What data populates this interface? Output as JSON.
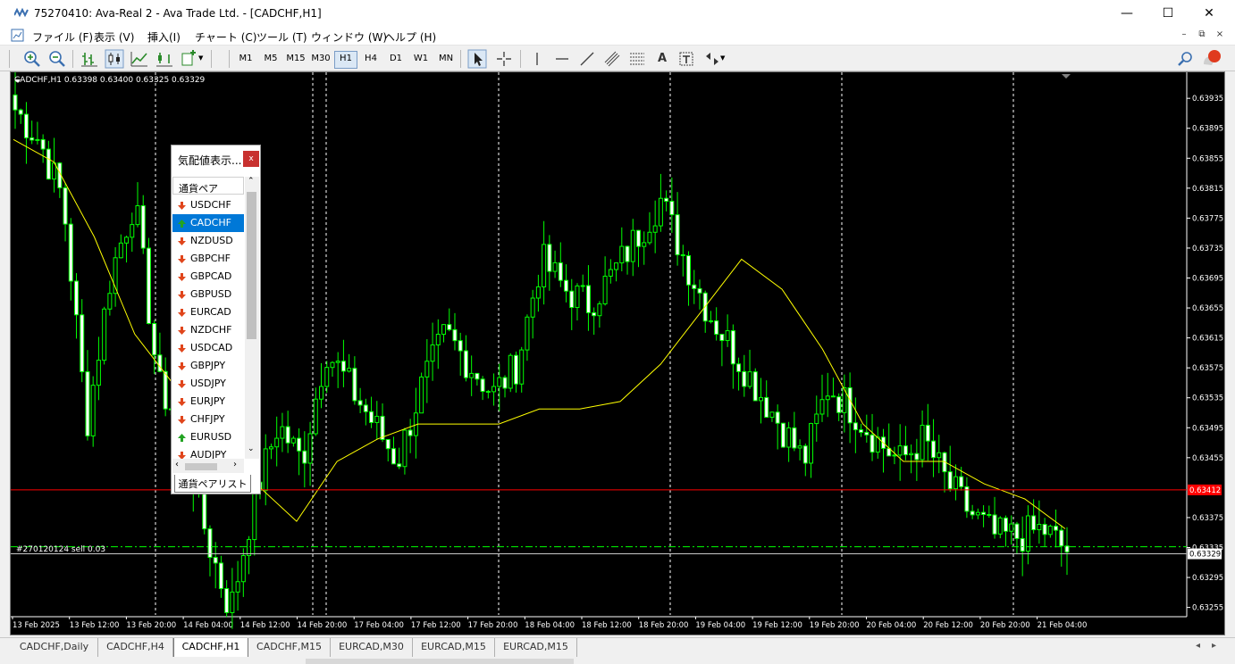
{
  "window": {
    "title": "75270410: Ava-Real 2 - Ava Trade Ltd. - [CADCHF,H1]"
  },
  "menu": [
    "ファイル (F)",
    "表示 (V)",
    "挿入(I)",
    "チャート (C)",
    "ツール (T)",
    "ウィンドウ (W)",
    "ヘルプ (H)"
  ],
  "toolbar": {
    "timeframes": [
      "M1",
      "M5",
      "M15",
      "M30",
      "H1",
      "H4",
      "D1",
      "W1",
      "MN"
    ],
    "active_timeframe": "H1",
    "notification_count": "1"
  },
  "chart": {
    "header": "CADCHF,H1  0.63398 0.63400 0.63325 0.63329",
    "order_label": "#270120124 sell 0.03",
    "bid_label": "0.63412",
    "current_label": "0.63329",
    "colors": {
      "candle_up": "#00ff00",
      "candle_down": "#ffffff",
      "ma": "#ffff00",
      "bid_line": "#ff0000",
      "order_line": "#00ff00"
    }
  },
  "chart_data": {
    "type": "candlestick",
    "symbol": "CADCHF",
    "timeframe": "H1",
    "y_ticks": [
      "0.63935",
      "0.63895",
      "0.63855",
      "0.63815",
      "0.63775",
      "0.63735",
      "0.63695",
      "0.63655",
      "0.63615",
      "0.63575",
      "0.63535",
      "0.63495",
      "0.63455",
      "0.63375",
      "0.63335",
      "0.63295",
      "0.63255"
    ],
    "ylim": [
      0.63245,
      0.63965
    ],
    "x_ticks": [
      "13 Feb 2025",
      "13 Feb 12:00",
      "13 Feb 20:00",
      "14 Feb 04:00",
      "14 Feb 12:00",
      "14 Feb 20:00",
      "17 Feb 04:00",
      "17 Feb 12:00",
      "17 Feb 20:00",
      "18 Feb 04:00",
      "18 Feb 12:00",
      "18 Feb 20:00",
      "19 Feb 04:00",
      "19 Feb 12:00",
      "19 Feb 20:00",
      "20 Feb 04:00",
      "20 Feb 12:00",
      "20 Feb 20:00",
      "21 Feb 04:00"
    ],
    "close_path": [
      0.6392,
      0.6388,
      0.638,
      0.635,
      0.637,
      0.638,
      0.6355,
      0.635,
      0.6335,
      0.6325,
      0.634,
      0.635,
      0.6345,
      0.636,
      0.6355,
      0.635,
      0.6345,
      0.6355,
      0.6362,
      0.6358,
      0.6354,
      0.6358,
      0.6372,
      0.6368,
      0.6366,
      0.637,
      0.6375,
      0.638,
      0.6372,
      0.6365,
      0.636,
      0.6355,
      0.635,
      0.6345,
      0.6355,
      0.6352,
      0.6348,
      0.6345,
      0.6348,
      0.6342,
      0.6338,
      0.6335,
      0.6335,
      0.6336,
      0.6333
    ],
    "ma_path": [
      0.6388,
      0.6385,
      0.6375,
      0.6362,
      0.6355,
      0.6348,
      0.6342,
      0.6337,
      0.6345,
      0.6348,
      0.635,
      0.635,
      0.635,
      0.6352,
      0.6352,
      0.6353,
      0.6358,
      0.6365,
      0.6372,
      0.6368,
      0.636,
      0.635,
      0.6345,
      0.6345,
      0.6342,
      0.634,
      0.6336
    ],
    "bid": 0.63412,
    "current": 0.63329,
    "order_level": 0.63336
  },
  "market_watch": {
    "title": "気配値表示...",
    "header": "通貨ペア",
    "symbols": [
      {
        "name": "USDCHF",
        "dir": "down"
      },
      {
        "name": "CADCHF",
        "dir": "up"
      },
      {
        "name": "NZDUSD",
        "dir": "down"
      },
      {
        "name": "GBPCHF",
        "dir": "down"
      },
      {
        "name": "GBPCAD",
        "dir": "down"
      },
      {
        "name": "GBPUSD",
        "dir": "down"
      },
      {
        "name": "EURCAD",
        "dir": "down"
      },
      {
        "name": "NZDCHF",
        "dir": "down"
      },
      {
        "name": "USDCAD",
        "dir": "down"
      },
      {
        "name": "GBPJPY",
        "dir": "down"
      },
      {
        "name": "USDJPY",
        "dir": "down"
      },
      {
        "name": "EURJPY",
        "dir": "down"
      },
      {
        "name": "CHFJPY",
        "dir": "down"
      },
      {
        "name": "EURUSD",
        "dir": "up"
      },
      {
        "name": "AUDJPY",
        "dir": "down"
      }
    ],
    "selected": "CADCHF",
    "tab": "通貨ペアリスト"
  },
  "tabs": [
    "CADCHF,Daily",
    "CADCHF,H4",
    "CADCHF,H1",
    "CADCHF,M15",
    "EURCAD,M30",
    "EURCAD,M15",
    "EURCAD,M15"
  ],
  "active_tab": "CADCHF,H1"
}
